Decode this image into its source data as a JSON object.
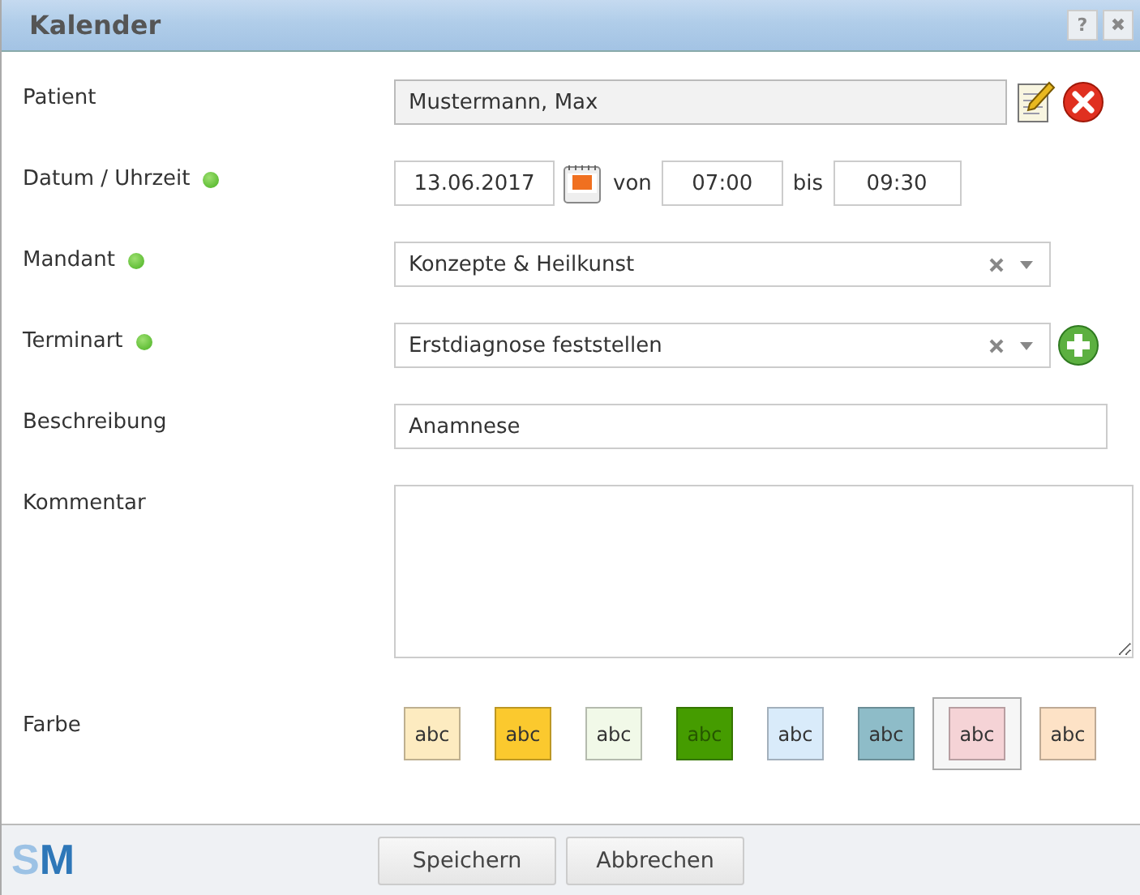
{
  "window": {
    "title": "Kalender",
    "buttons": [
      "?",
      "✖"
    ]
  },
  "fields": [
    {
      "kind": "patient",
      "label": "Patient",
      "required": false,
      "value": "Mustermann, Max"
    },
    {
      "kind": "datetime",
      "label": "Datum / Uhrzeit",
      "required": true,
      "date": "13.06.2017",
      "from_label": "von",
      "from": "07:00",
      "to_label": "bis",
      "to": "09:30"
    },
    {
      "kind": "select",
      "label": "Mandant",
      "required": true,
      "value": "Konzepte & Heilkunst",
      "add": false
    },
    {
      "kind": "select",
      "label": "Terminart",
      "required": true,
      "value": "Erstdiagnose feststellen",
      "add": true
    },
    {
      "kind": "text",
      "label": "Beschreibung",
      "required": false,
      "value": "Anamnese"
    },
    {
      "kind": "textarea",
      "label": "Kommentar",
      "required": false
    },
    {
      "kind": "colors",
      "label": "Farbe",
      "required": false,
      "swatches": [
        {
          "text": "abc",
          "color": "#fdebc0",
          "selected": false
        },
        {
          "text": "abc",
          "color": "#fbc92e",
          "selected": false
        },
        {
          "text": "abc",
          "color": "#f1f9e8",
          "selected": false
        },
        {
          "text": "abc",
          "color": "#459c00",
          "selected": false
        },
        {
          "text": "abc",
          "color": "#d9ebfa",
          "selected": false
        },
        {
          "text": "abc",
          "color": "#8ebcc8",
          "selected": false
        },
        {
          "text": "abc",
          "color": "#f5d3d6",
          "selected": true
        },
        {
          "text": "abc",
          "color": "#fde2c6",
          "selected": false
        }
      ]
    }
  ],
  "footer": {
    "logo": [
      "S",
      "M"
    ],
    "buttons": [
      "Speichern",
      "Abbrechen"
    ]
  }
}
